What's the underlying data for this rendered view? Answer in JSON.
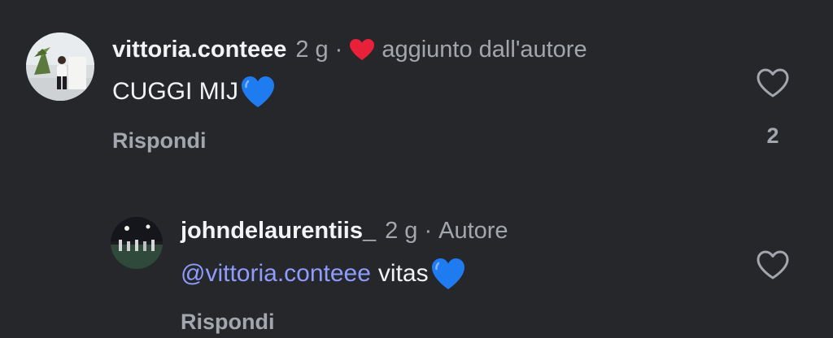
{
  "colors": {
    "background": "#26272a",
    "text_primary": "#f2f3f5",
    "text_secondary": "#a3a6ad",
    "mention": "#8e9cff",
    "author_like_heart": "#e8203a",
    "emoji_heart": "#1f7bf0"
  },
  "comments": [
    {
      "username": "vittoria.conteee",
      "time": "2 g",
      "separator": "·",
      "author_liked_icon": "red-heart-icon",
      "tag": "aggiunto dall'autore",
      "text": "CUGGI MIJ",
      "emoji": "blue-heart-emoji",
      "reply_label": "Rispondi",
      "like_icon": "heart-outline-icon",
      "like_count": "2"
    },
    {
      "username": "johndelaurentiis_",
      "time": "2 g",
      "separator": "·",
      "tag": "Autore",
      "mention": "@vittoria.conteee",
      "text": "vitas",
      "emoji": "blue-heart-emoji",
      "reply_label": "Rispondi",
      "like_icon": "heart-outline-icon"
    }
  ]
}
